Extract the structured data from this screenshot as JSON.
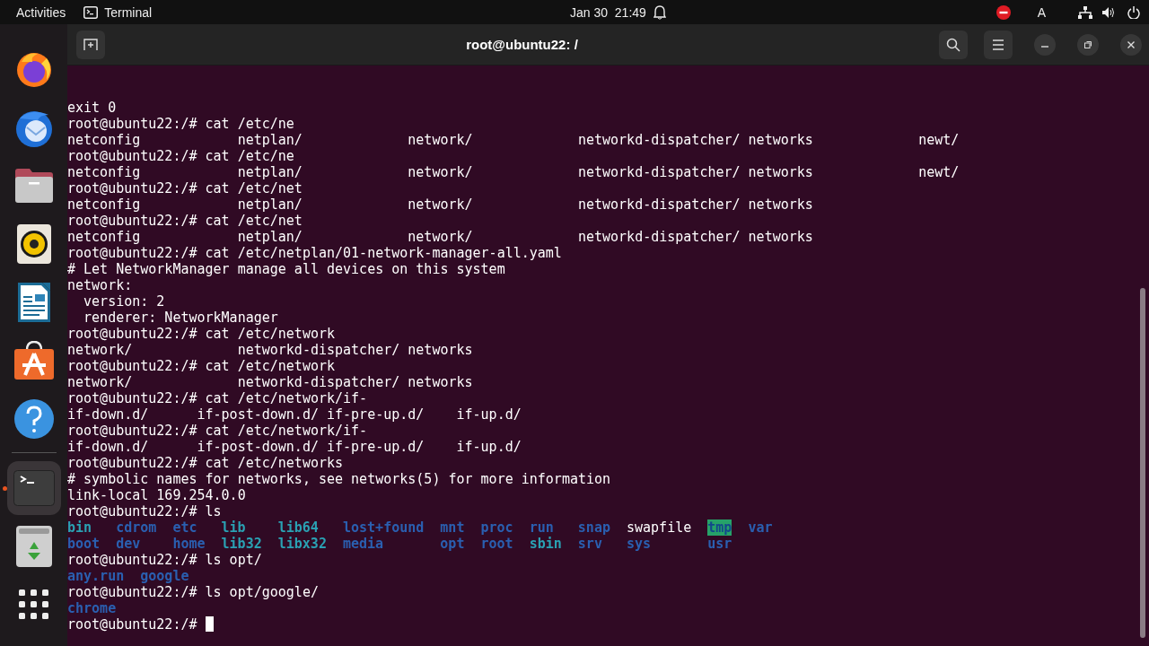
{
  "top_bar": {
    "activities": "Activities",
    "app_menu": "Terminal",
    "date": "Jan 30",
    "time": "21:49",
    "keyboard": "A"
  },
  "dock": {
    "items": [
      {
        "kind": "firefox",
        "selected": false,
        "running": false
      },
      {
        "kind": "thunderbird",
        "selected": false,
        "running": false
      },
      {
        "kind": "files",
        "selected": false,
        "running": false
      },
      {
        "kind": "rhythmbox",
        "selected": false,
        "running": false
      },
      {
        "kind": "writer",
        "selected": false,
        "running": false
      },
      {
        "kind": "appcenter",
        "selected": false,
        "running": false
      },
      {
        "kind": "help",
        "selected": false,
        "running": false
      },
      {
        "kind": "separator"
      },
      {
        "kind": "terminal",
        "selected": true,
        "running": true
      },
      {
        "kind": "trash",
        "selected": false,
        "running": false
      },
      {
        "kind": "apps",
        "selected": false,
        "running": false
      }
    ]
  },
  "window": {
    "title": "root@ubuntu22: /"
  },
  "terminal": {
    "cursor": true,
    "lines": [
      {
        "text": "exit 0"
      },
      {
        "text": "root@ubuntu22:/# cat /etc/ne"
      },
      {
        "text": "netconfig            netplan/             network/             networkd-dispatcher/ networks             newt/"
      },
      {
        "text": "root@ubuntu22:/# cat /etc/ne"
      },
      {
        "text": "netconfig            netplan/             network/             networkd-dispatcher/ networks             newt/"
      },
      {
        "text": "root@ubuntu22:/# cat /etc/net"
      },
      {
        "text": "netconfig            netplan/             network/             networkd-dispatcher/ networks"
      },
      {
        "text": "root@ubuntu22:/# cat /etc/net"
      },
      {
        "text": "netconfig            netplan/             network/             networkd-dispatcher/ networks"
      },
      {
        "text": "root@ubuntu22:/# cat /etc/netplan/01-network-manager-all.yaml"
      },
      {
        "text": "# Let NetworkManager manage all devices on this system"
      },
      {
        "text": "network:"
      },
      {
        "text": "  version: 2"
      },
      {
        "text": "  renderer: NetworkManager"
      },
      {
        "text": "root@ubuntu22:/# cat /etc/network"
      },
      {
        "text": "network/             networkd-dispatcher/ networks"
      },
      {
        "text": "root@ubuntu22:/# cat /etc/network"
      },
      {
        "text": "network/             networkd-dispatcher/ networks"
      },
      {
        "text": "root@ubuntu22:/# cat /etc/network/if-"
      },
      {
        "text": "if-down.d/      if-post-down.d/ if-pre-up.d/    if-up.d/"
      },
      {
        "text": "root@ubuntu22:/# cat /etc/network/if-"
      },
      {
        "text": "if-down.d/      if-post-down.d/ if-pre-up.d/    if-up.d/"
      },
      {
        "text": "root@ubuntu22:/# cat /etc/networks"
      },
      {
        "text": "# symbolic names for networks, see networks(5) for more information"
      },
      {
        "text": "link-local 169.254.0.0"
      },
      {
        "text": "root@ubuntu22:/# ls"
      },
      {
        "kind": "ls",
        "rows": [
          [
            {
              "name": "bin",
              "kind": "link"
            },
            {
              "name": "cdrom",
              "kind": "dir"
            },
            {
              "name": "etc",
              "kind": "dir"
            },
            {
              "name": "lib",
              "kind": "link"
            },
            {
              "name": "lib64",
              "kind": "link"
            },
            {
              "name": "lost+found",
              "kind": "dir"
            },
            {
              "name": "mnt",
              "kind": "dir"
            },
            {
              "name": "proc",
              "kind": "dir"
            },
            {
              "name": "run",
              "kind": "dir"
            },
            {
              "name": "snap",
              "kind": "dir"
            },
            {
              "name": "swapfile",
              "kind": "file"
            },
            {
              "name": "tmp",
              "kind": "sticky"
            },
            {
              "name": "var",
              "kind": "dir"
            }
          ],
          [
            {
              "name": "boot",
              "kind": "dir"
            },
            {
              "name": "dev",
              "kind": "dir"
            },
            {
              "name": "home",
              "kind": "dir"
            },
            {
              "name": "lib32",
              "kind": "link"
            },
            {
              "name": "libx32",
              "kind": "link"
            },
            {
              "name": "media",
              "kind": "dir"
            },
            {
              "name": "opt",
              "kind": "dir"
            },
            {
              "name": "root",
              "kind": "dir"
            },
            {
              "name": "sbin",
              "kind": "link"
            },
            {
              "name": "srv",
              "kind": "dir"
            },
            {
              "name": "sys",
              "kind": "dir"
            },
            {
              "name": "usr",
              "kind": "dir"
            }
          ]
        ]
      },
      {
        "text": "root@ubuntu22:/# ls opt/"
      },
      {
        "kind": "ls",
        "rows": [
          [
            {
              "name": "any.run",
              "kind": "dir"
            },
            {
              "name": "google",
              "kind": "dir"
            }
          ]
        ]
      },
      {
        "text": "root@ubuntu22:/# ls opt/google/"
      },
      {
        "kind": "ls",
        "rows": [
          [
            {
              "name": "chrome",
              "kind": "dir"
            }
          ]
        ]
      },
      {
        "text": "root@ubuntu22:/#"
      }
    ]
  }
}
